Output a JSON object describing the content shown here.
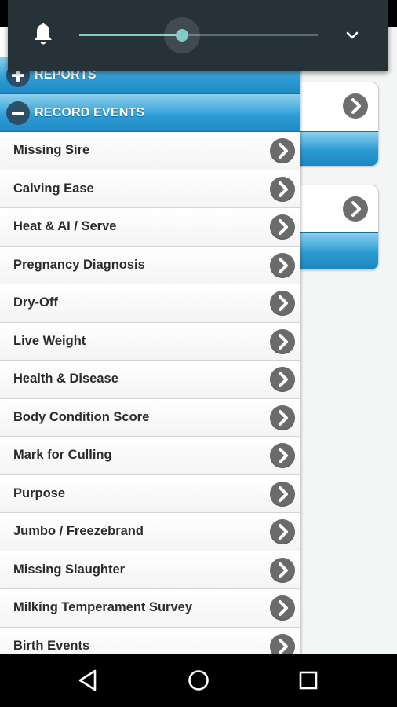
{
  "volume": {
    "icon": "bell-icon",
    "level": 0.43,
    "accent": "#80cbc4",
    "expand_icon": "chevron-down-icon"
  },
  "drawer": {
    "sections": [
      {
        "label": "REPORTS",
        "state": "collapsed",
        "icon": "plus-icon"
      },
      {
        "label": "RECORD EVENTS",
        "state": "expanded",
        "icon": "minus-icon"
      }
    ],
    "items": [
      {
        "label": "Missing Sire"
      },
      {
        "label": "Calving Ease"
      },
      {
        "label": "Heat & AI / Serve"
      },
      {
        "label": "Pregnancy Diagnosis"
      },
      {
        "label": "Dry-Off"
      },
      {
        "label": "Live Weight"
      },
      {
        "label": "Health & Disease"
      },
      {
        "label": "Body Condition Score"
      },
      {
        "label": "Mark for Culling"
      },
      {
        "label": "Purpose"
      },
      {
        "label": "Jumbo / Freezebrand"
      },
      {
        "label": "Missing Slaughter"
      },
      {
        "label": "Milking Temperament Survey"
      },
      {
        "label": "Birth Events"
      }
    ],
    "header_color": "#2c9bd4",
    "arrow_color": "#6b6b6b"
  },
  "navbar": {
    "back_icon": "back-triangle-icon",
    "home_icon": "home-circle-icon",
    "recent_icon": "recent-apps-square-icon"
  }
}
